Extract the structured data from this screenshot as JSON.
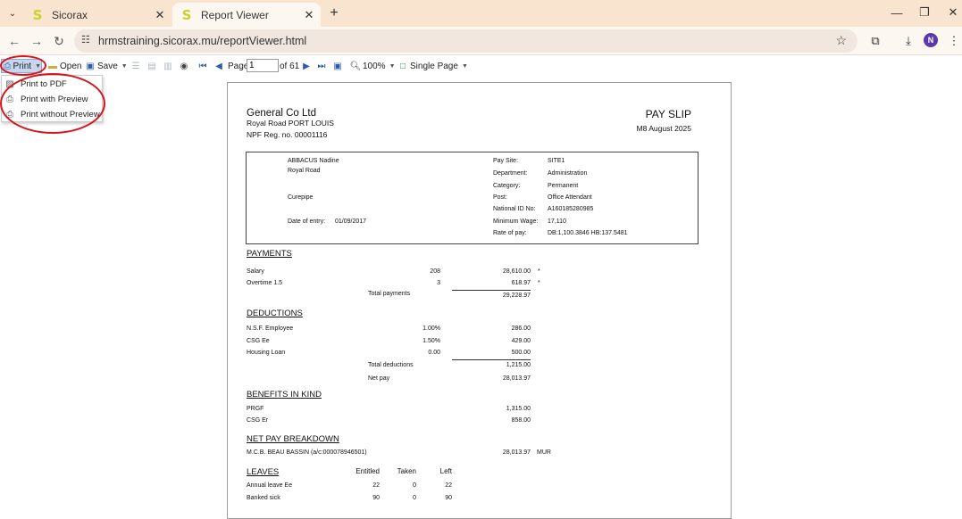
{
  "browser": {
    "tabs": [
      {
        "title": "Sicorax",
        "favicon": "S",
        "active": false
      },
      {
        "title": "Report Viewer",
        "favicon": "S",
        "active": true
      }
    ],
    "url": "hrmstraining.sicorax.mu/reportViewer.html",
    "profile_initial": "N"
  },
  "toolbar": {
    "print_label": "Print",
    "open_label": "Open",
    "save_label": "Save",
    "page_label": "Page",
    "page_value": "1",
    "page_of": "of 61",
    "zoom_label": "100%",
    "view_mode_label": "Single Page"
  },
  "print_menu": {
    "items": [
      {
        "label": "Print to PDF",
        "icon": "pdf-icon"
      },
      {
        "label": "Print with Preview",
        "icon": "print-preview-icon"
      },
      {
        "label": "Print without Preview",
        "icon": "printer-icon"
      }
    ]
  },
  "annotation_color": "#d6141c",
  "report": {
    "company": {
      "name": "General Co Ltd",
      "address": "Royal Road PORT LOUIS",
      "npf": "NPF Reg. no. 00001116"
    },
    "title": "PAY SLIP",
    "period": "M8 August 2025",
    "employee": {
      "name": "ABBACUS Nadine",
      "address1": "Royal Road",
      "address2": "Curepipe",
      "entry_label": "Date of entry:",
      "entry_value": "01/09/2017",
      "fields": [
        {
          "label": "Pay Site:",
          "value": "SITE1"
        },
        {
          "label": "Department:",
          "value": "Administration"
        },
        {
          "label": "Category:",
          "value": "Permanent"
        },
        {
          "label": "Post:",
          "value": "Office Attendant"
        },
        {
          "label": "National ID No:",
          "value": "A160185280985"
        },
        {
          "label": "Minimum Wage:",
          "value": "17,110"
        },
        {
          "label": "Rate of pay:",
          "value": "DB:1,100.3846 HB:137.5481"
        }
      ]
    },
    "payments": {
      "title": "PAYMENTS",
      "rows": [
        {
          "label": "Salary",
          "qty": "208",
          "amount": "28,610.00",
          "mark": "*"
        },
        {
          "label": "Overtime 1.5",
          "qty": "3",
          "amount": "618.97",
          "mark": "*"
        }
      ],
      "total_label": "Total payments",
      "total": "29,228.97"
    },
    "deductions": {
      "title": "DEDUCTIONS",
      "rows": [
        {
          "label": "N.S.F. Employee",
          "qty": "1.00%",
          "amount": "286.00"
        },
        {
          "label": "CSG Ee",
          "qty": "1.50%",
          "amount": "429.00"
        },
        {
          "label": "Housing Loan",
          "qty": "0.00",
          "amount": "500.00"
        }
      ],
      "total_label": "Total deductions",
      "total": "1,215.00",
      "net_label": "Net pay",
      "net": "28,013.97"
    },
    "benefits": {
      "title": "BENEFITS IN KIND",
      "rows": [
        {
          "label": "PRGF",
          "amount": "1,315.00"
        },
        {
          "label": "CSG Er",
          "amount": "858.00"
        }
      ]
    },
    "breakdown": {
      "title": "NET PAY BREAKDOWN",
      "bank": "M.C.B. BEAU BASSIN (a/c:000078946501)",
      "amount": "28,013.97",
      "currency": "MUR"
    },
    "leaves": {
      "title": "LEAVES",
      "headers": [
        "Entitled",
        "Taken",
        "Left"
      ],
      "rows": [
        {
          "label": "Annual leave Ee",
          "entitled": "22",
          "taken": "0",
          "left": "22"
        },
        {
          "label": "Banked sick",
          "entitled": "90",
          "taken": "0",
          "left": "90"
        }
      ]
    }
  }
}
